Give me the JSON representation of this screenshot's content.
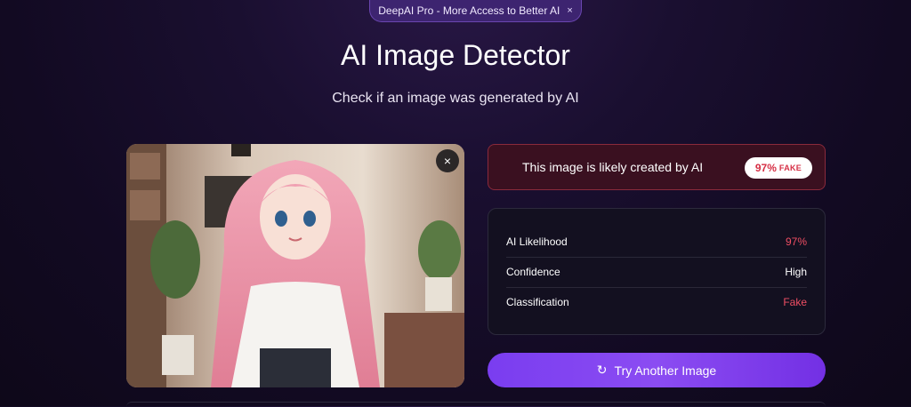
{
  "promo": {
    "text": "DeepAI Pro - More Access to Better AI",
    "close": "×"
  },
  "page": {
    "title": "AI Image Detector",
    "subtitle": "Check if an image was generated by AI"
  },
  "image": {
    "close": "×"
  },
  "verdict": {
    "message": "This image is likely created by AI",
    "badge_percent": "97%",
    "badge_label": "FAKE",
    "accent": "#d62f45"
  },
  "stats": [
    {
      "label": "AI Likelihood",
      "value": "97%"
    },
    {
      "label": "Confidence",
      "value": "High"
    },
    {
      "label": "Classification",
      "value": "Fake"
    }
  ],
  "actions": {
    "try_again": "Try Another Image",
    "icon": "refresh-icon"
  },
  "colors": {
    "primary": "#7a3df0",
    "danger": "#ef4e63",
    "background": "#120a22"
  }
}
